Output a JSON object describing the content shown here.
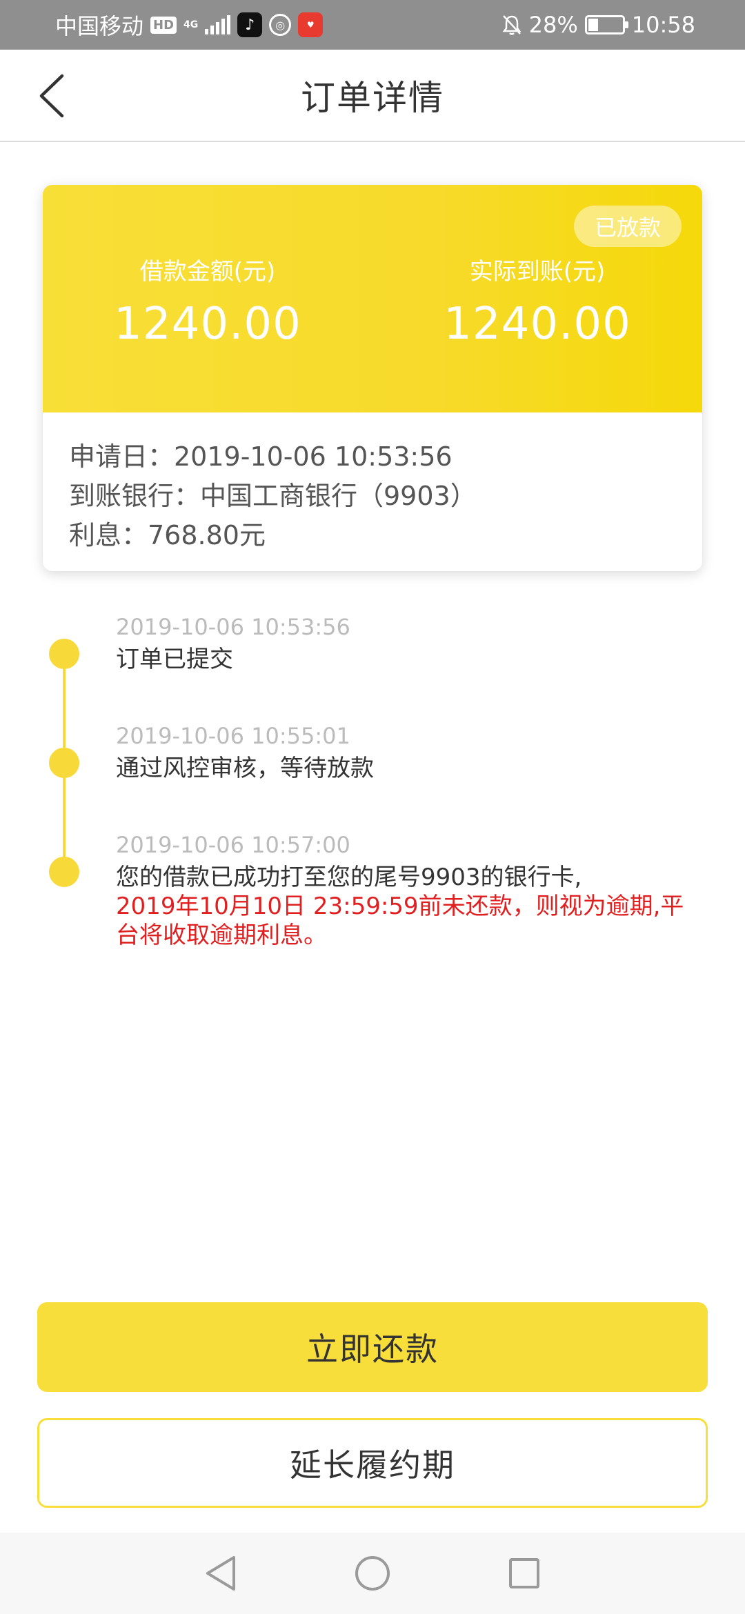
{
  "status_bar": {
    "carrier": "中国移动",
    "hd_badge": "HD",
    "network": "4G",
    "apps": [
      "tiktok-icon",
      "unionpay-icon",
      "shop-icon"
    ],
    "battery_percent": "28%",
    "battery_level": 0.28,
    "time": "10:58"
  },
  "header": {
    "title": "订单详情",
    "back_icon": "chevron-left-icon"
  },
  "card": {
    "status_badge": "已放款",
    "loan_amount_label": "借款金额(元)",
    "loan_amount_value": "1240.00",
    "received_amount_label": "实际到账(元)",
    "received_amount_value": "1240.00",
    "apply_date": "申请日：2019-10-06 10:53:56",
    "bank": "到账银行：中国工商银行（9903）",
    "interest": "利息：768.80元",
    "colors": {
      "accent": "#f7da2a",
      "text_on_accent": "#ffffff"
    }
  },
  "timeline": {
    "items": [
      {
        "time": "2019-10-06 10:53:56",
        "text": "订单已提交"
      },
      {
        "time": "2019-10-06 10:55:01",
        "text": "通过风控审核，等待放款"
      },
      {
        "time": "2019-10-06 10:57:00",
        "text": "您的借款已成功打至您的尾号9903的银行卡,",
        "warning": "2019年10月10日 23:59:59前未还款，则视为逾期,平台将收取逾期利息。"
      }
    ],
    "colors": {
      "dot": "#f7d93a",
      "warning": "#e02020"
    }
  },
  "actions": {
    "repay_now": "立即还款",
    "extend": "延长履约期"
  },
  "nav_bar": {
    "icons": [
      "back-triangle-icon",
      "home-circle-icon",
      "recents-square-icon"
    ]
  }
}
